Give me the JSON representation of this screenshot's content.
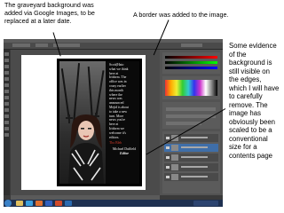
{
  "annotations": {
    "top_left": "The graveyard background was added via Google Images, to be replaced at a later date.",
    "top_center": "A border was added to the image.",
    "right": "Some evidence of the background is still visible on the edges, which I will have to carefully remove. The image has obviously been scaled to be a conventional size for a contents page"
  },
  "cover": {
    "text_lines": [
      "Scott(Hato",
      "what we think",
      "here at",
      "Iridorm. The",
      "office was in",
      "crazy earlier",
      "this month",
      "where the",
      "news was",
      "announced",
      "Mejid is about",
      "to take a new",
      "turn. More",
      "news you're",
      "here at",
      "Iridorm we",
      "welcome it's",
      "editors."
    ],
    "red_line": "Thx Bleh",
    "signature": "Michael Duffield",
    "editor_label": "Editor"
  },
  "colors": {
    "ps_dark": "#3a3a3a",
    "panel_gray": "#535353",
    "taskbar_blue": "#1e3050",
    "accent_red": "#d03a2a"
  }
}
